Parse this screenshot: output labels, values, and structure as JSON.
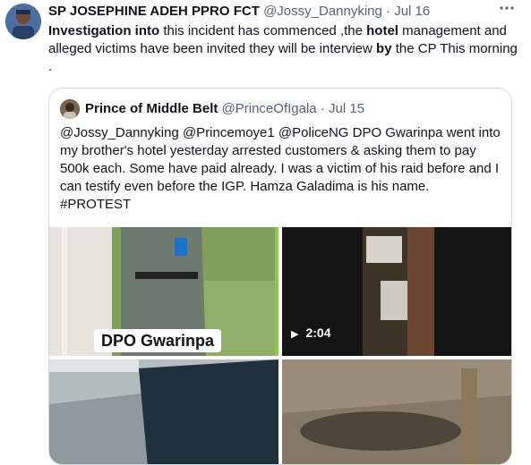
{
  "tweet": {
    "author_name": "SP JOSEPHINE ADEH PPRO FCT",
    "handle": "@Jossy_Dannyking",
    "separator": "·",
    "date": "Jul 16",
    "more_icon": "more-icon",
    "text_parts": [
      {
        "text": "Investigation into",
        "bold": true
      },
      {
        "text": " this incident has commenced ,the ",
        "bold": false
      },
      {
        "text": "hotel",
        "bold": true
      },
      {
        "text": " management and alleged victims have been invited they will be interview ",
        "bold": false
      },
      {
        "text": "by",
        "bold": true
      },
      {
        "text": " the CP This morning .",
        "bold": false
      }
    ]
  },
  "quote": {
    "author_name": "Prince of Middle Belt",
    "handle": "@PrinceOfIgala",
    "separator": "·",
    "date": "Jul 15",
    "text": "@Jossy_Dannyking @Princemoye1 @PoliceNG DPO Gwarinpa went into my brother's hotel yesterday arrested customers & asking them to pay 500k each. Some have paid already. I was a victim of his raid before and I can testify even before the IGP. Hamza Galadima is his name. #PROTEST",
    "media": {
      "photo1_label": "DPO Gwarinpa",
      "video_duration": "2:04",
      "play_icon": "play-icon"
    }
  }
}
